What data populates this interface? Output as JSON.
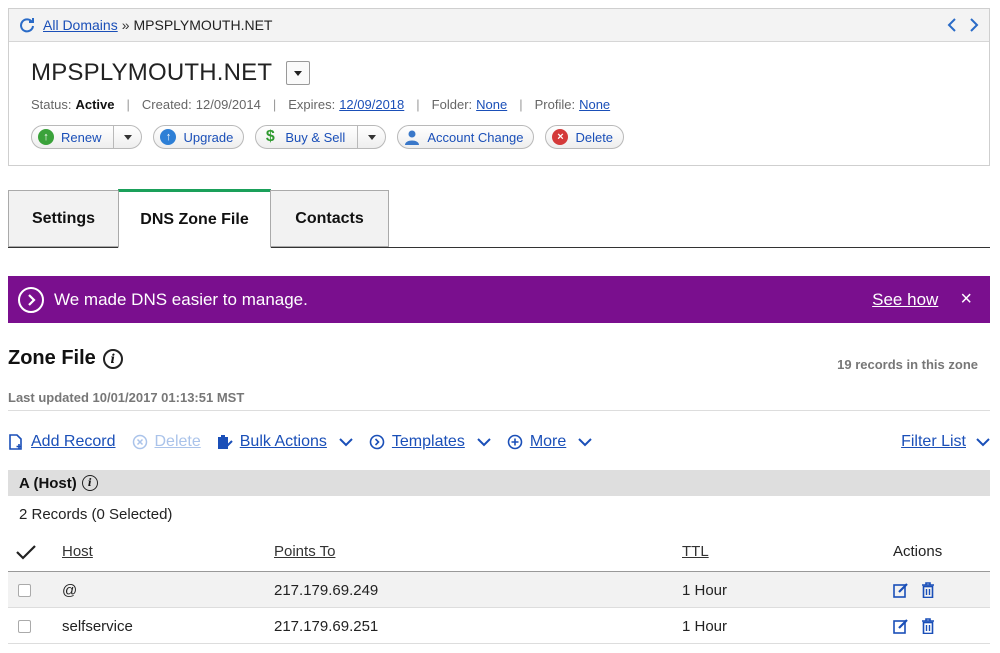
{
  "breadcrumb": {
    "root": "All Domains",
    "separator": "»",
    "current": "MPSPLYMOUTH.NET"
  },
  "domain": {
    "name": "MPSPLYMOUTH.NET",
    "status_label": "Status:",
    "status": "Active",
    "created_label": "Created:",
    "created": "12/09/2014",
    "expires_label": "Expires:",
    "expires": "12/09/2018",
    "folder_label": "Folder:",
    "folder": "None",
    "profile_label": "Profile:",
    "profile": "None"
  },
  "actions": {
    "renew": "Renew",
    "upgrade": "Upgrade",
    "buy_sell": "Buy & Sell",
    "account_change": "Account Change",
    "delete": "Delete"
  },
  "tabs": [
    {
      "label": "Settings",
      "active": false
    },
    {
      "label": "DNS Zone File",
      "active": true
    },
    {
      "label": "Contacts",
      "active": false
    }
  ],
  "banner": {
    "text": "We made DNS easier to manage.",
    "link": "See how",
    "close": "×",
    "color": "#7a0f8e"
  },
  "zone": {
    "title": "Zone File",
    "record_count": "19 records in this zone",
    "last_updated": "Last updated 10/01/2017 01:13:51 MST"
  },
  "toolbar": {
    "add_record": "Add Record",
    "delete": "Delete",
    "bulk_actions": "Bulk Actions",
    "templates": "Templates",
    "more": "More",
    "filter_list": "Filter List"
  },
  "section": {
    "title": "A (Host)",
    "records": "2 Records (0 Selected)"
  },
  "table": {
    "headers": {
      "host": "Host",
      "points_to": "Points To",
      "ttl": "TTL",
      "actions": "Actions"
    },
    "rows": [
      {
        "host": "@",
        "points_to": "217.179.69.249",
        "ttl": "1 Hour"
      },
      {
        "host": "selfservice",
        "points_to": "217.179.69.251",
        "ttl": "1 Hour"
      }
    ]
  },
  "colors": {
    "accent": "#1a4fb8",
    "tab_active": "#1aa05a",
    "banner": "#7a0f8e"
  }
}
